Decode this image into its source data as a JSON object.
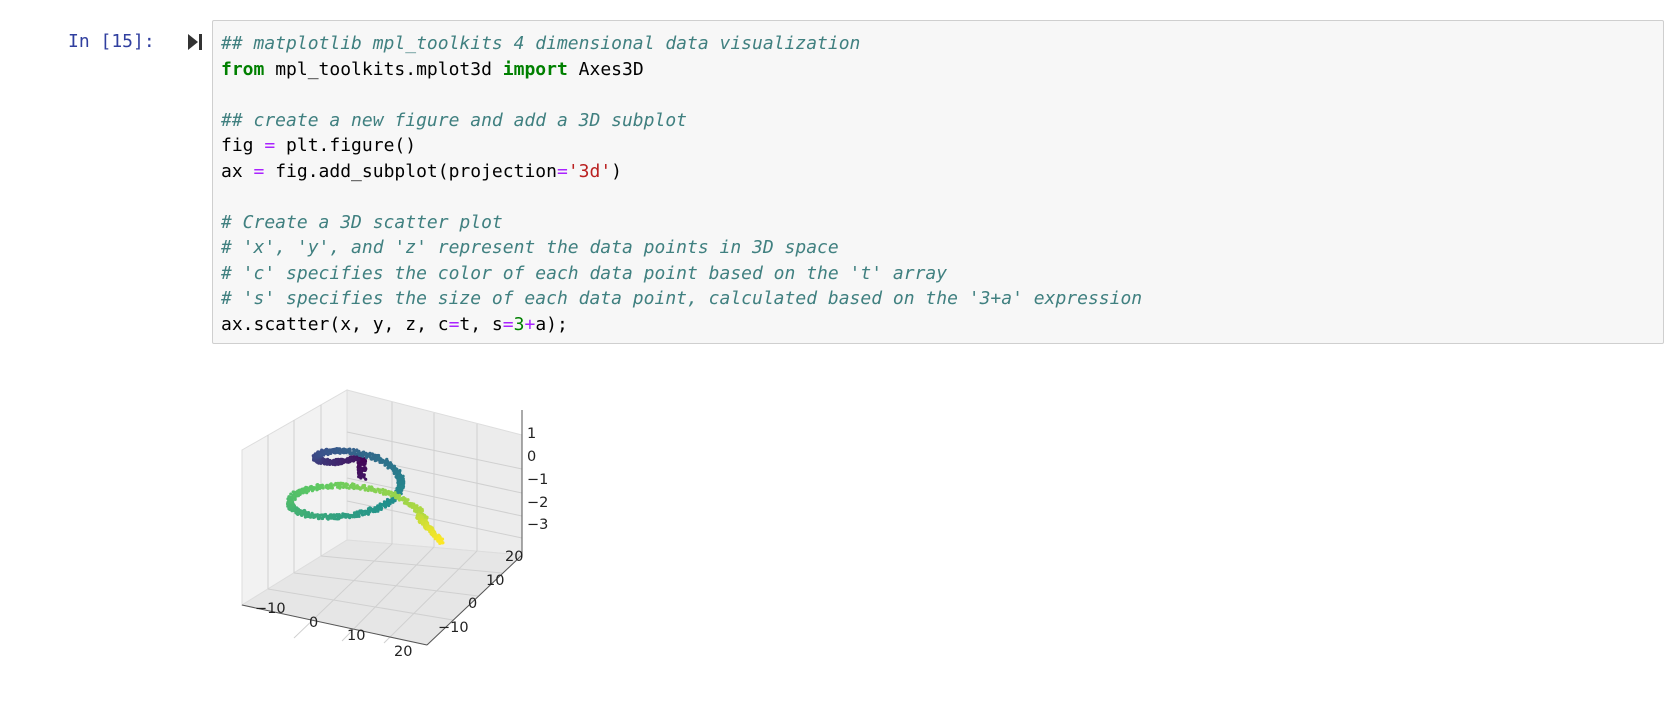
{
  "cell": {
    "prompt": "In [15]:",
    "code_lines": [
      [
        {
          "t": "## matplotlib mpl_toolkits 4 dimensional data visualization",
          "c": "comment"
        }
      ],
      [
        {
          "t": "from",
          "c": "kw"
        },
        {
          "t": " mpl_toolkits.mplot3d ",
          "c": ""
        },
        {
          "t": "import",
          "c": "kw"
        },
        {
          "t": " Axes3D",
          "c": ""
        }
      ],
      [],
      [
        {
          "t": "## create a new figure and add a 3D subplot",
          "c": "comment"
        }
      ],
      [
        {
          "t": "fig ",
          "c": ""
        },
        {
          "t": "=",
          "c": "op"
        },
        {
          "t": " plt.figure()",
          "c": ""
        }
      ],
      [
        {
          "t": "ax ",
          "c": ""
        },
        {
          "t": "=",
          "c": "op"
        },
        {
          "t": " fig.add_subplot(projection",
          "c": ""
        },
        {
          "t": "=",
          "c": "op"
        },
        {
          "t": "'3d'",
          "c": "str"
        },
        {
          "t": ")",
          "c": ""
        }
      ],
      [],
      [
        {
          "t": "# Create a 3D scatter plot",
          "c": "comment"
        }
      ],
      [
        {
          "t": "# 'x', 'y', and 'z' represent the data points in 3D space",
          "c": "comment"
        }
      ],
      [
        {
          "t": "# 'c' specifies the color of each data point based on the 't' array",
          "c": "comment"
        }
      ],
      [
        {
          "t": "# 's' specifies the size of each data point, calculated based on the '3+a' expression",
          "c": "comment"
        }
      ],
      [
        {
          "t": "ax.scatter(x, y, z, c",
          "c": ""
        },
        {
          "t": "=",
          "c": "op"
        },
        {
          "t": "t, s",
          "c": ""
        },
        {
          "t": "=",
          "c": "op"
        },
        {
          "t": "3",
          "c": "num"
        },
        {
          "t": "+",
          "c": "op"
        },
        {
          "t": "a);",
          "c": ""
        }
      ]
    ]
  },
  "chart_data": {
    "type": "scatter",
    "projection": "3d",
    "colormap": "viridis",
    "z_ticks": [
      "1",
      "0",
      "−1",
      "−2",
      "−3"
    ],
    "x_ticks": [
      "−10",
      "0",
      "10",
      "20"
    ],
    "y_ticks": [
      "20",
      "10",
      "0",
      "−10"
    ],
    "description_of_shape": "helical spiral winding from dark purple at top center to yellow at bottom",
    "colors": [
      "#440154",
      "#3b528b",
      "#21918c",
      "#5ec962",
      "#fde725"
    ]
  }
}
